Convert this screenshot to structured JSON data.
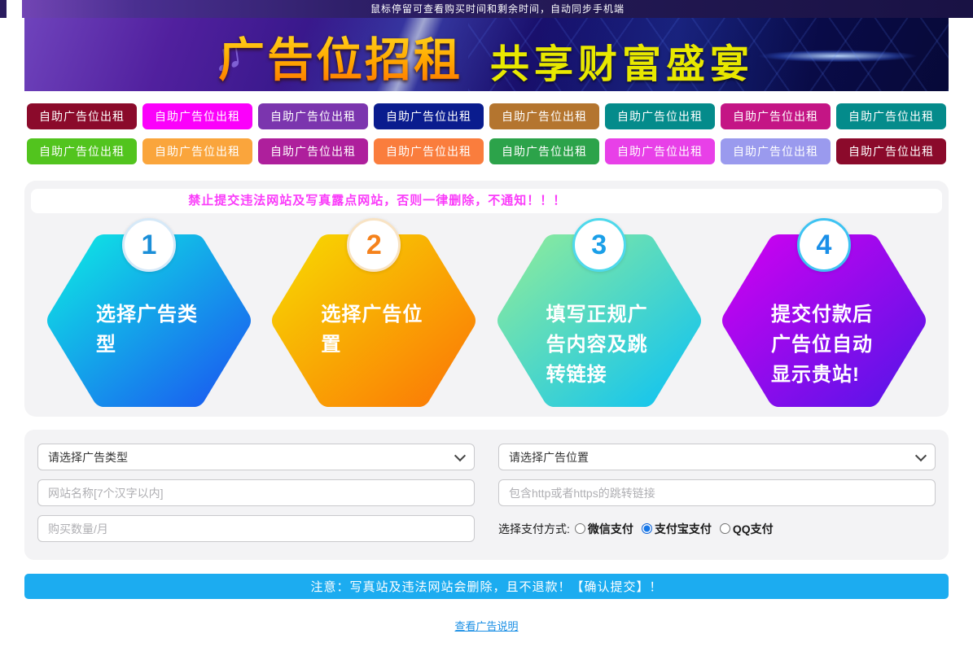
{
  "topbar": {
    "text": "鼠标停留可查看购买时间和剩余时间，自动同步手机端"
  },
  "banner": {
    "title": "广告位招租",
    "subtitle": "共享财富盛宴",
    "subtitle_color": "#e8e800",
    "music_icon": "♫"
  },
  "ad_buttons": {
    "label": "自助广告位出租",
    "row1_colors": [
      "#8b0a2b",
      "#fb00fb",
      "#7b35ae",
      "#0a1c8e",
      "#b4752f",
      "#048b8b",
      "#c41585",
      "#048b8b"
    ],
    "row2_colors": [
      "#52c41e",
      "#faa53c",
      "#ae1f9c",
      "#fa7d3d",
      "#2ca34a",
      "#e840e8",
      "#9a9aee",
      "#8b0a2b"
    ]
  },
  "steps": {
    "warning": "禁止提交违法网站及写真露点网站，否则一律删除，不通知！！！",
    "warning_color": "#fa3cfa",
    "items": [
      {
        "number": "1",
        "text": "选择广告类型",
        "gradient_start": "#0fe4e4",
        "gradient_end": "#1a5bf0",
        "number_color": "#1b8fd8",
        "ring_color": "#d6e9f8"
      },
      {
        "number": "2",
        "text": "选择广告位置",
        "gradient_start": "#f7d502",
        "gradient_end": "#fb7a06",
        "number_color": "#f5821c",
        "ring_color": "#f8e3c4"
      },
      {
        "number": "3",
        "text": "填写正规广告内容及跳转链接",
        "gradient_start": "#8aea9e",
        "gradient_end": "#12c4f0",
        "number_color": "#1a9fe8",
        "ring_color": "#4ed9ec"
      },
      {
        "number": "4",
        "text": "提交付款后广告位自动显示贵站!",
        "gradient_start": "#cb02f0",
        "gradient_end": "#5a14e8",
        "number_color": "#1a8fe8",
        "ring_color": "#3ec3f2"
      }
    ]
  },
  "form": {
    "type_select_value": "请选择广告类型",
    "position_select_value": "请选择广告位置",
    "site_name_placeholder": "网站名称[7个汉字以内]",
    "link_placeholder": "包含http或者https的跳转链接",
    "quantity_placeholder": "购买数量/月",
    "payment_label": "选择支付方式:",
    "payment_options": [
      {
        "label": "微信支付",
        "selected": false
      },
      {
        "label": "支付宝支付",
        "selected": true
      },
      {
        "label": "QQ支付",
        "selected": false
      }
    ]
  },
  "submit": {
    "text": "注意：写真站及违法网站会删除，且不退款！【确认提交】！",
    "color": "#1cacf0"
  },
  "footer": {
    "link": "查看广告说明",
    "link_color": "#1a8fe5"
  }
}
